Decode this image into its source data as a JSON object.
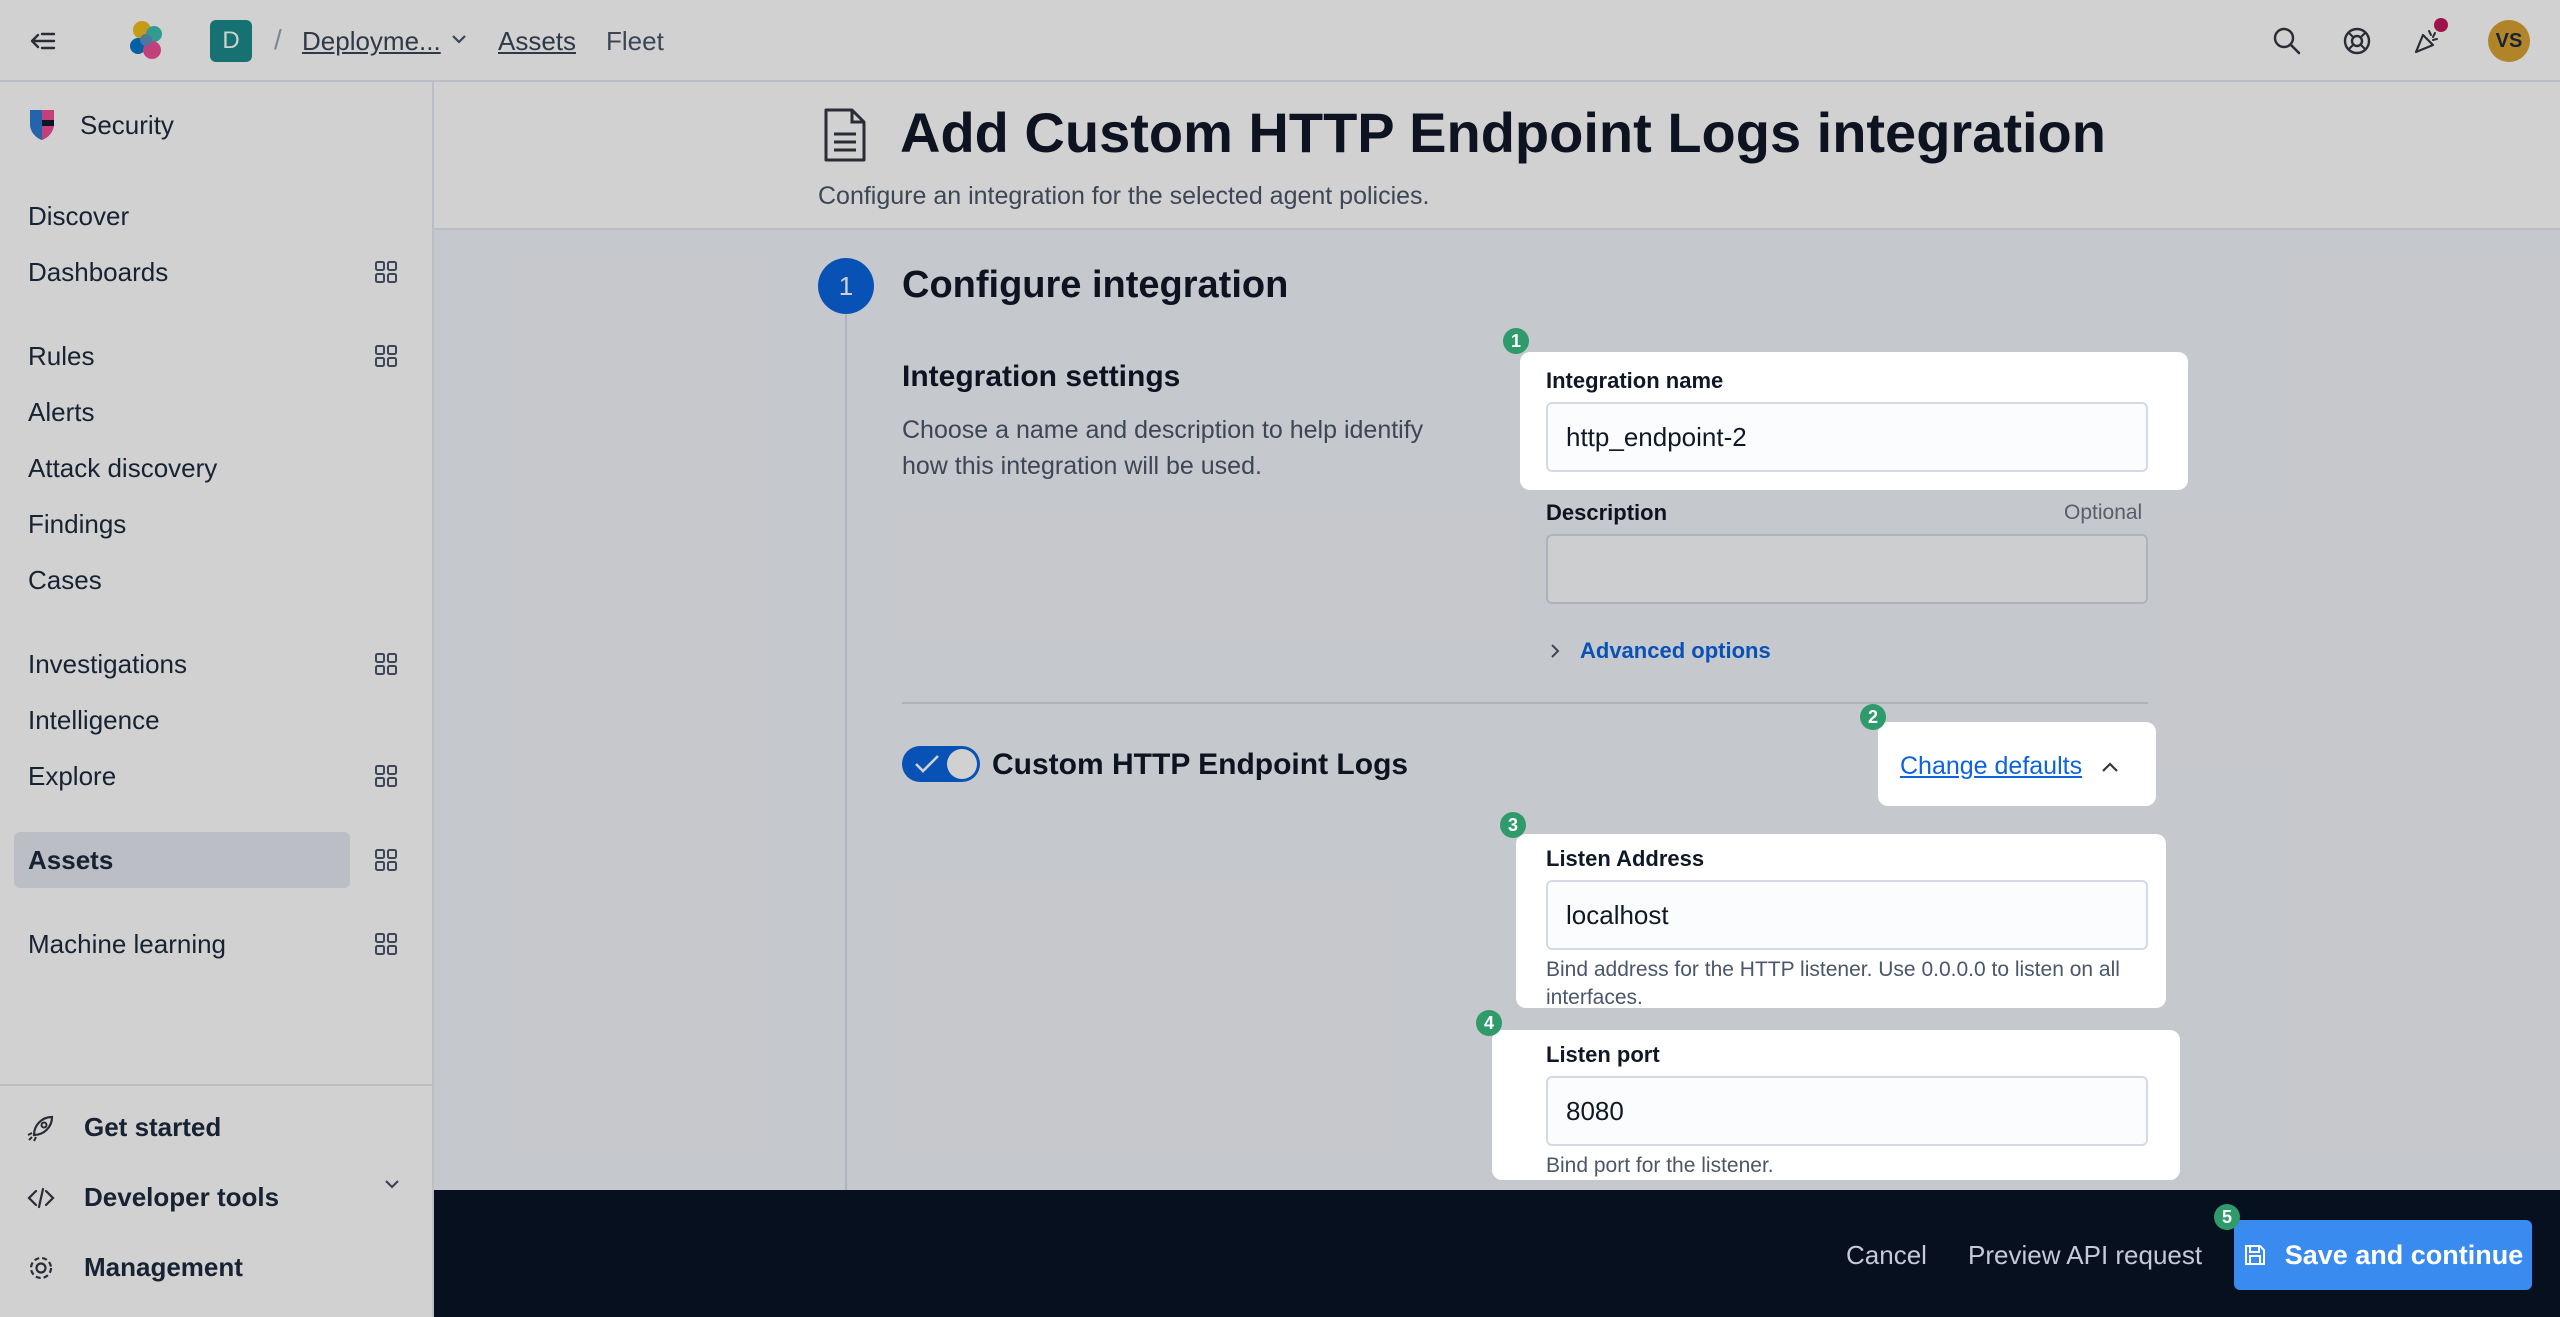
{
  "topbar": {
    "space_initial": "D",
    "breadcrumb_separator": "/",
    "breadcrumb_deployment": "Deployme...",
    "breadcrumb_assets": "Assets",
    "breadcrumb_fleet": "Fleet",
    "avatar_initials": "VS",
    "icons": [
      "collapse-nav-icon",
      "elastic-logo-icon",
      "search-icon",
      "help-icon",
      "newsfeed-icon"
    ]
  },
  "sidebar": {
    "brand": "Security",
    "items": [
      {
        "label": "Discover",
        "grid": false
      },
      {
        "label": "Dashboards",
        "grid": true
      },
      {
        "label": "Rules",
        "grid": true
      },
      {
        "label": "Alerts",
        "grid": false
      },
      {
        "label": "Attack discovery",
        "grid": false
      },
      {
        "label": "Findings",
        "grid": false
      },
      {
        "label": "Cases",
        "grid": false
      },
      {
        "label": "Investigations",
        "grid": true
      },
      {
        "label": "Intelligence",
        "grid": false
      },
      {
        "label": "Explore",
        "grid": true
      },
      {
        "label": "Assets",
        "grid": true,
        "active": true
      },
      {
        "label": "Machine learning",
        "grid": true
      }
    ],
    "bottom": {
      "get_started": "Get started",
      "developer_tools": "Developer tools",
      "management": "Management"
    }
  },
  "header": {
    "title": "Add Custom HTTP Endpoint Logs integration",
    "subtitle": "Configure an integration for the selected agent policies."
  },
  "step": {
    "number": "1",
    "title": "Configure integration"
  },
  "settings": {
    "title": "Integration settings",
    "description": "Choose a name and description to help identify how this integration will be used.",
    "name_label": "Integration name",
    "name_value": "http_endpoint-2",
    "description_label": "Description",
    "description_optional": "Optional",
    "description_value": "",
    "advanced_options": "Advanced options"
  },
  "integration": {
    "enabled": true,
    "title": "Custom HTTP Endpoint Logs",
    "change_defaults": "Change defaults",
    "listen_address_label": "Listen Address",
    "listen_address_value": "localhost",
    "listen_address_help": "Bind address for the HTTP listener. Use 0.0.0.0 to listen on all interfaces.",
    "listen_port_label": "Listen port",
    "listen_port_value": "8080",
    "listen_port_help": "Bind port for the listener."
  },
  "markers": [
    "1",
    "2",
    "3",
    "4",
    "5"
  ],
  "footer": {
    "cancel": "Cancel",
    "preview": "Preview API request",
    "save": "Save and continue"
  },
  "colors": {
    "accent": "#0b64dd",
    "marker": "#2f9a6a",
    "footer_bg": "#07101f",
    "save_button": "#3a8bf0",
    "space_badge": "#1b8a8a",
    "avatar": "#d9a132"
  }
}
